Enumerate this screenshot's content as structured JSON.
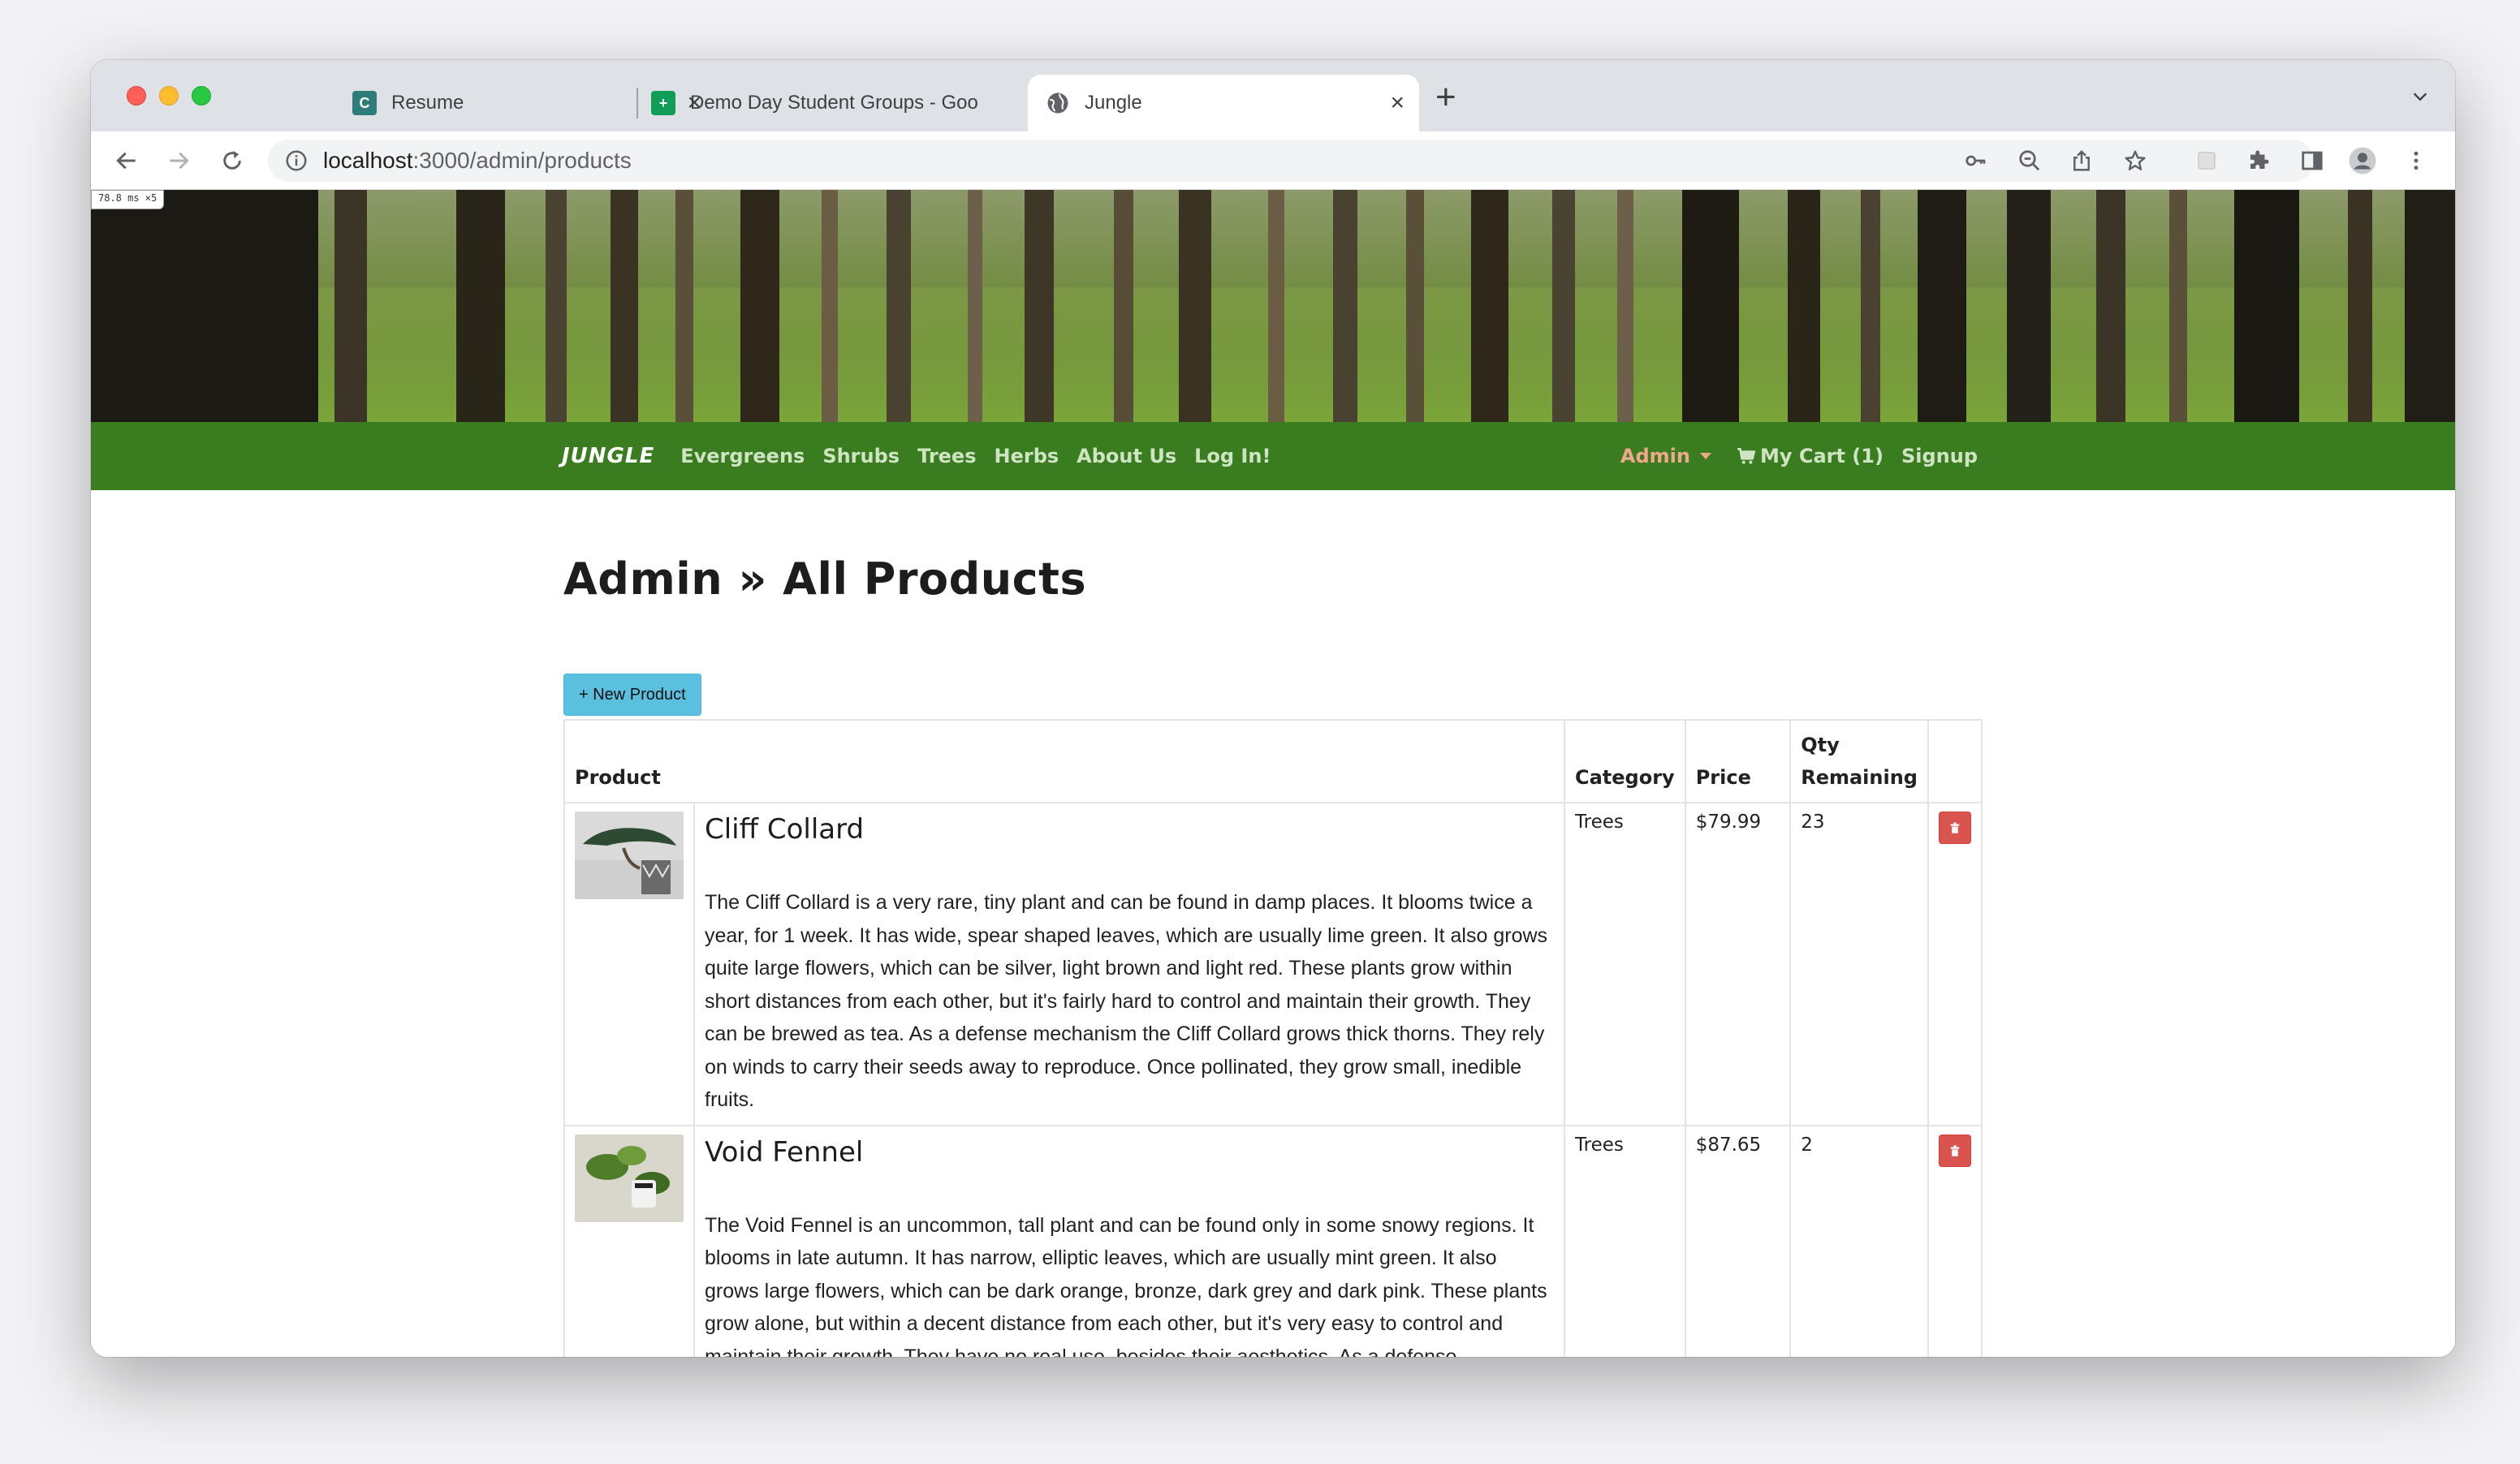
{
  "browser": {
    "tabs": [
      {
        "title": "Resume",
        "favicon": "C",
        "favicon_color": "#2e7d7a",
        "active": false
      },
      {
        "title": "Demo Day Student Groups - Goo",
        "favicon": "+",
        "favicon_color": "#0f9d58",
        "active": false
      },
      {
        "title": "Jungle",
        "favicon": "globe-icon",
        "active": true
      }
    ],
    "url_host": "localhost",
    "url_rest": ":3000/admin/products",
    "perf_badge": "78.8 ms ×5"
  },
  "nav": {
    "brand": "JUNGLE",
    "links": [
      "Evergreens",
      "Shrubs",
      "Trees",
      "Herbs",
      "About Us",
      "Log In!"
    ],
    "admin_label": "Admin",
    "cart_label": "My Cart (1)",
    "signup_label": "Signup",
    "colors": {
      "navbar": "#3a7d20",
      "admin": "#f0a88a"
    }
  },
  "page": {
    "title": "Admin » All Products",
    "new_button": "+ New Product"
  },
  "table": {
    "headers": {
      "product": "Product",
      "category": "Category",
      "price": "Price",
      "qty_line1": "Qty",
      "qty_line2": "Remaining"
    },
    "rows": [
      {
        "name": "Cliff Collard",
        "description": "The Cliff Collard is a very rare, tiny plant and can be found in damp places. It blooms twice a year, for 1 week. It has wide, spear shaped leaves, which are usually lime green. It also grows quite large flowers, which can be silver, light brown and light red. These plants grow within short distances from each other, but it's fairly hard to control and maintain their growth. They can be brewed as tea. As a defense mechanism the Cliff Collard grows thick thorns. They rely on winds to carry their seeds away to reproduce. Once pollinated, they grow small, inedible fruits.",
        "category": "Trees",
        "price": "$79.99",
        "qty": "23"
      },
      {
        "name": "Void Fennel",
        "description": "The Void Fennel is an uncommon, tall plant and can be found only in some snowy regions. It blooms in late autumn. It has narrow, elliptic leaves, which are usually mint green. It also grows large flowers, which can be dark orange, bronze, dark grey and dark pink. These plants grow alone, but within a decent distance from each other, but it's very easy to control and maintain their growth. They have no real use, besides their aesthetics. As a defense mechanism the Void",
        "category": "Trees",
        "price": "$87.65",
        "qty": "2"
      }
    ]
  }
}
